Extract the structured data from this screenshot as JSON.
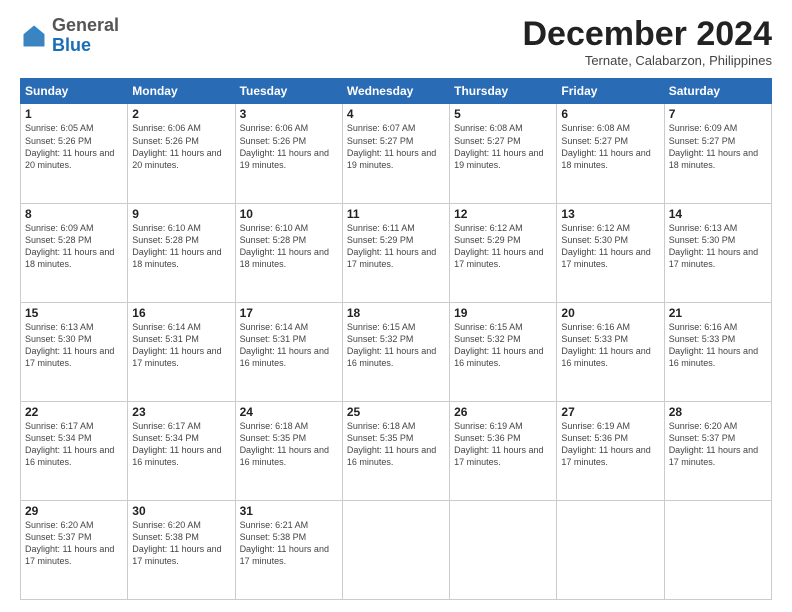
{
  "header": {
    "logo": {
      "general": "General",
      "blue": "Blue"
    },
    "title": "December 2024",
    "location": "Ternate, Calabarzon, Philippines"
  },
  "calendar": {
    "days_of_week": [
      "Sunday",
      "Monday",
      "Tuesday",
      "Wednesday",
      "Thursday",
      "Friday",
      "Saturday"
    ],
    "weeks": [
      [
        null,
        null,
        {
          "day": 1,
          "sunrise": "6:05 AM",
          "sunset": "5:26 PM",
          "daylight": "11 hours and 20 minutes."
        },
        {
          "day": 2,
          "sunrise": "6:06 AM",
          "sunset": "5:26 PM",
          "daylight": "11 hours and 20 minutes."
        },
        {
          "day": 3,
          "sunrise": "6:06 AM",
          "sunset": "5:26 PM",
          "daylight": "11 hours and 19 minutes."
        },
        {
          "day": 4,
          "sunrise": "6:07 AM",
          "sunset": "5:27 PM",
          "daylight": "11 hours and 19 minutes."
        },
        {
          "day": 5,
          "sunrise": "6:08 AM",
          "sunset": "5:27 PM",
          "daylight": "11 hours and 19 minutes."
        },
        {
          "day": 6,
          "sunrise": "6:08 AM",
          "sunset": "5:27 PM",
          "daylight": "11 hours and 18 minutes."
        },
        {
          "day": 7,
          "sunrise": "6:09 AM",
          "sunset": "5:27 PM",
          "daylight": "11 hours and 18 minutes."
        }
      ],
      [
        {
          "day": 8,
          "sunrise": "6:09 AM",
          "sunset": "5:28 PM",
          "daylight": "11 hours and 18 minutes."
        },
        {
          "day": 9,
          "sunrise": "6:10 AM",
          "sunset": "5:28 PM",
          "daylight": "11 hours and 18 minutes."
        },
        {
          "day": 10,
          "sunrise": "6:10 AM",
          "sunset": "5:28 PM",
          "daylight": "11 hours and 18 minutes."
        },
        {
          "day": 11,
          "sunrise": "6:11 AM",
          "sunset": "5:29 PM",
          "daylight": "11 hours and 17 minutes."
        },
        {
          "day": 12,
          "sunrise": "6:12 AM",
          "sunset": "5:29 PM",
          "daylight": "11 hours and 17 minutes."
        },
        {
          "day": 13,
          "sunrise": "6:12 AM",
          "sunset": "5:30 PM",
          "daylight": "11 hours and 17 minutes."
        },
        {
          "day": 14,
          "sunrise": "6:13 AM",
          "sunset": "5:30 PM",
          "daylight": "11 hours and 17 minutes."
        }
      ],
      [
        {
          "day": 15,
          "sunrise": "6:13 AM",
          "sunset": "5:30 PM",
          "daylight": "11 hours and 17 minutes."
        },
        {
          "day": 16,
          "sunrise": "6:14 AM",
          "sunset": "5:31 PM",
          "daylight": "11 hours and 17 minutes."
        },
        {
          "day": 17,
          "sunrise": "6:14 AM",
          "sunset": "5:31 PM",
          "daylight": "11 hours and 16 minutes."
        },
        {
          "day": 18,
          "sunrise": "6:15 AM",
          "sunset": "5:32 PM",
          "daylight": "11 hours and 16 minutes."
        },
        {
          "day": 19,
          "sunrise": "6:15 AM",
          "sunset": "5:32 PM",
          "daylight": "11 hours and 16 minutes."
        },
        {
          "day": 20,
          "sunrise": "6:16 AM",
          "sunset": "5:33 PM",
          "daylight": "11 hours and 16 minutes."
        },
        {
          "day": 21,
          "sunrise": "6:16 AM",
          "sunset": "5:33 PM",
          "daylight": "11 hours and 16 minutes."
        }
      ],
      [
        {
          "day": 22,
          "sunrise": "6:17 AM",
          "sunset": "5:34 PM",
          "daylight": "11 hours and 16 minutes."
        },
        {
          "day": 23,
          "sunrise": "6:17 AM",
          "sunset": "5:34 PM",
          "daylight": "11 hours and 16 minutes."
        },
        {
          "day": 24,
          "sunrise": "6:18 AM",
          "sunset": "5:35 PM",
          "daylight": "11 hours and 16 minutes."
        },
        {
          "day": 25,
          "sunrise": "6:18 AM",
          "sunset": "5:35 PM",
          "daylight": "11 hours and 16 minutes."
        },
        {
          "day": 26,
          "sunrise": "6:19 AM",
          "sunset": "5:36 PM",
          "daylight": "11 hours and 17 minutes."
        },
        {
          "day": 27,
          "sunrise": "6:19 AM",
          "sunset": "5:36 PM",
          "daylight": "11 hours and 17 minutes."
        },
        {
          "day": 28,
          "sunrise": "6:20 AM",
          "sunset": "5:37 PM",
          "daylight": "11 hours and 17 minutes."
        }
      ],
      [
        {
          "day": 29,
          "sunrise": "6:20 AM",
          "sunset": "5:37 PM",
          "daylight": "11 hours and 17 minutes."
        },
        {
          "day": 30,
          "sunrise": "6:20 AM",
          "sunset": "5:38 PM",
          "daylight": "11 hours and 17 minutes."
        },
        {
          "day": 31,
          "sunrise": "6:21 AM",
          "sunset": "5:38 PM",
          "daylight": "11 hours and 17 minutes."
        },
        null,
        null,
        null,
        null
      ]
    ]
  }
}
